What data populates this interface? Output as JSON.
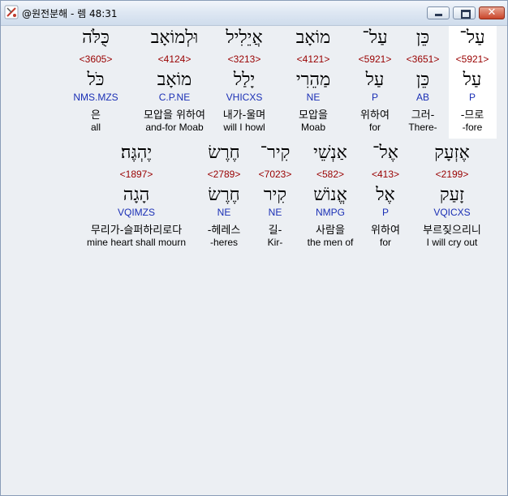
{
  "window": {
    "title": "@원전분해 - 렘 48:31",
    "close_label": "✕",
    "accent_color": "#c9452a"
  },
  "rows": [
    {
      "words": [
        {
          "hebrew": "עַל־",
          "strong": "<5921>",
          "lemma": "עַל",
          "parse": "P",
          "korean": "-므로",
          "english": "-fore",
          "selected": true
        },
        {
          "hebrew": "כֵּן",
          "strong": "<3651>",
          "lemma": "כֵּן",
          "parse": "AB",
          "korean": "그러-",
          "english": "There-"
        },
        {
          "hebrew": "עַל־",
          "strong": "<5921>",
          "lemma": "עַל",
          "parse": "P",
          "korean": "위하여",
          "english": "for"
        },
        {
          "hebrew": "מוֹאָב",
          "strong": "<4121>",
          "lemma": "מַהֵרִי",
          "parse": "NE",
          "korean": "모압을",
          "english": "Moab"
        },
        {
          "hebrew": "אֲיֵלִיל",
          "strong": "<3213>",
          "lemma": "יָלַל",
          "parse": "VHICXS",
          "korean": "내가-울며",
          "english": "will I howl"
        },
        {
          "hebrew": "וּלְמוֹאָב",
          "strong": "<4124>",
          "lemma": "מוֹאָב",
          "parse": "C.P.NE",
          "korean": "모압을 위하여",
          "english": "and-for Moab"
        },
        {
          "hebrew": "כֻּלֹּה",
          "strong": "<3605>",
          "lemma": "כֹּל",
          "parse": "NMS.MZS",
          "korean": "은",
          "english": "all"
        }
      ]
    },
    {
      "words": [
        {
          "hebrew": "אֶזְעָק",
          "strong": "<2199>",
          "lemma": "זָעַק",
          "parse": "VQICXS",
          "korean": "부르짖으리니",
          "english": "I will cry out"
        },
        {
          "hebrew": "אֶל־",
          "strong": "<413>",
          "lemma": "אֶל",
          "parse": "P",
          "korean": "위하여",
          "english": "for"
        },
        {
          "hebrew": "אַנְשֵׁי",
          "strong": "<582>",
          "lemma": "אֱנוֹשׁ",
          "parse": "NMPG",
          "korean": "사람을",
          "english": "the men of"
        },
        {
          "hebrew": "קִיר־",
          "strong": "<7023>",
          "lemma": "קִיר",
          "parse": "NE",
          "korean": "길-",
          "english": "Kir-"
        },
        {
          "hebrew": "חֶרֶשׂ",
          "strong": "<2789>",
          "lemma": "חֶרֶשׂ",
          "parse": "NE",
          "korean": "-헤레스",
          "english": "-heres"
        },
        {
          "hebrew": "יֶהְגֶּה׃",
          "strong": "<1897>",
          "lemma": "הָגָה",
          "parse": "VQIMZS",
          "korean": "무리가-슬퍼하리로다",
          "english": "mine heart shall mourn"
        }
      ]
    }
  ]
}
